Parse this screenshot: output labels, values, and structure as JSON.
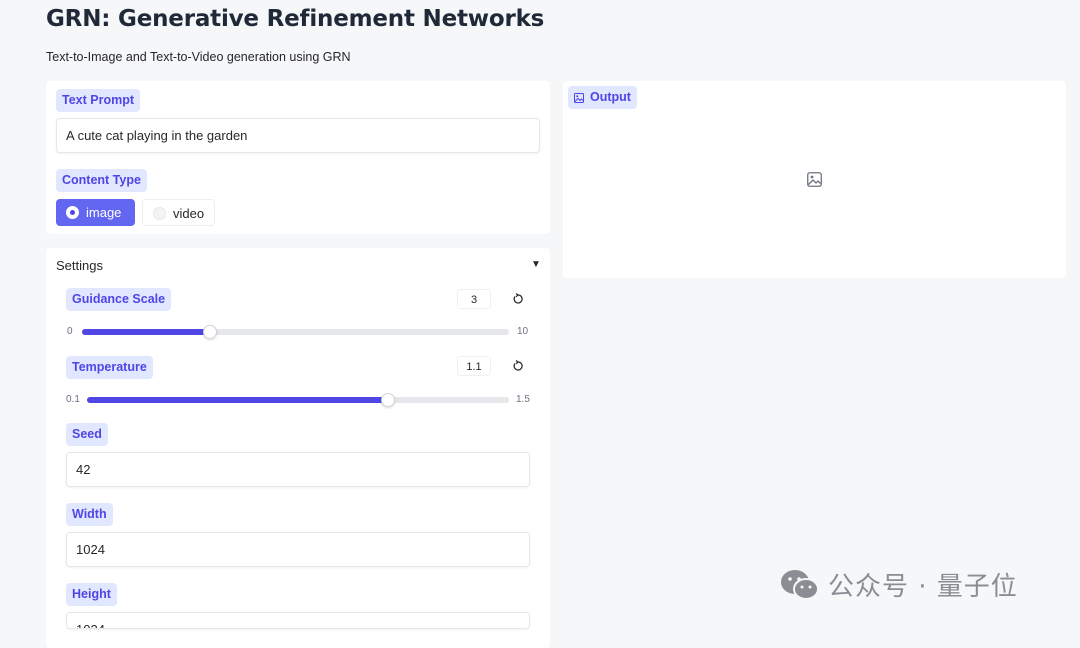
{
  "header": {
    "title": "GRN: Generative Refinement Networks",
    "subtitle": "Text-to-Image and Text-to-Video generation using GRN"
  },
  "prompt": {
    "label": "Text Prompt",
    "value": "A cute cat playing in the garden"
  },
  "content_type": {
    "label": "Content Type",
    "options": [
      "image",
      "video"
    ],
    "selected": "image"
  },
  "output": {
    "label": "Output"
  },
  "settings": {
    "title": "Settings",
    "caret": "▼",
    "guidance": {
      "label": "Guidance Scale",
      "value": "3",
      "min": "0",
      "max": "10",
      "fraction": 0.3
    },
    "temperature": {
      "label": "Temperature",
      "value": "1.1",
      "min": "0.1",
      "max": "1.5",
      "fraction": 0.714
    },
    "seed": {
      "label": "Seed",
      "value": "42"
    },
    "width": {
      "label": "Width",
      "value": "1024"
    },
    "height": {
      "label": "Height",
      "value": "1024"
    }
  },
  "watermark": {
    "text": "公众号 · 量子位"
  },
  "colors": {
    "accent": "#6366f1",
    "chip_bg": "#e0e7ff",
    "chip_text": "#4f46e5"
  }
}
